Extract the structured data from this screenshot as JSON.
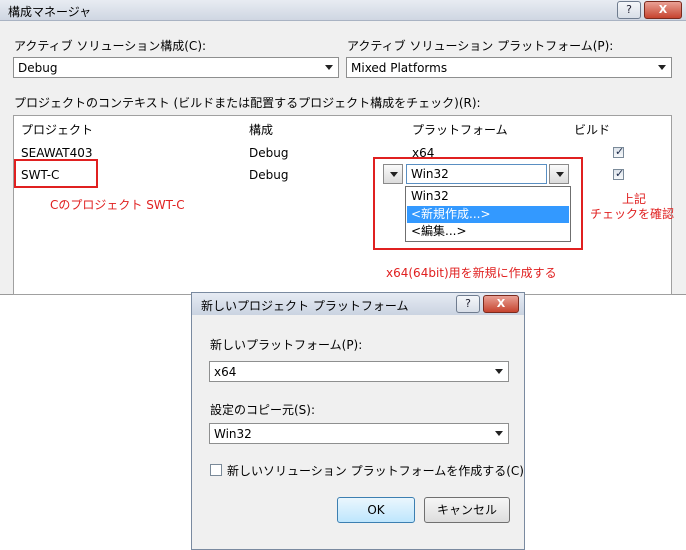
{
  "config_manager": {
    "title": "構成マネージャ",
    "help": "?",
    "close": "X",
    "active_config_label": "アクティブ ソリューション構成(C):",
    "active_config_value": "Debug",
    "active_platform_label": "アクティブ ソリューション プラットフォーム(P):",
    "active_platform_value": "Mixed Platforms",
    "context_label": "プロジェクトのコンテキスト (ビルドまたは配置するプロジェクト構成をチェック)(R):",
    "columns": [
      "プロジェクト",
      "構成",
      "プラットフォーム",
      "ビルド"
    ],
    "rows": [
      {
        "project": "SEAWAT403",
        "config": "Debug",
        "platform": "x64",
        "build": true
      },
      {
        "project": "SWT-C",
        "config": "Debug",
        "platform": "Win32",
        "build": true
      }
    ],
    "platform_dropdown": [
      "Win32",
      "<新規作成...>",
      "<編集...>"
    ],
    "platform_dropdown_selected_index": 1
  },
  "annotations": {
    "swtc_note": "Cのプロジェクト SWT-C",
    "check_note_1": "上記",
    "check_note_2": "チェックを確認",
    "x64_note": "x64(64bit)用を新規に作成する"
  },
  "new_platform": {
    "title": "新しいプロジェクト プラットフォーム",
    "help": "?",
    "close": "X",
    "new_platform_label": "新しいプラットフォーム(P):",
    "new_platform_value": "x64",
    "copy_from_label": "設定のコピー元(S):",
    "copy_from_value": "Win32",
    "create_solution_label": "新しいソリューション プラットフォームを作成する(C)",
    "create_solution_checked": false,
    "ok": "OK",
    "cancel": "キャンセル"
  }
}
